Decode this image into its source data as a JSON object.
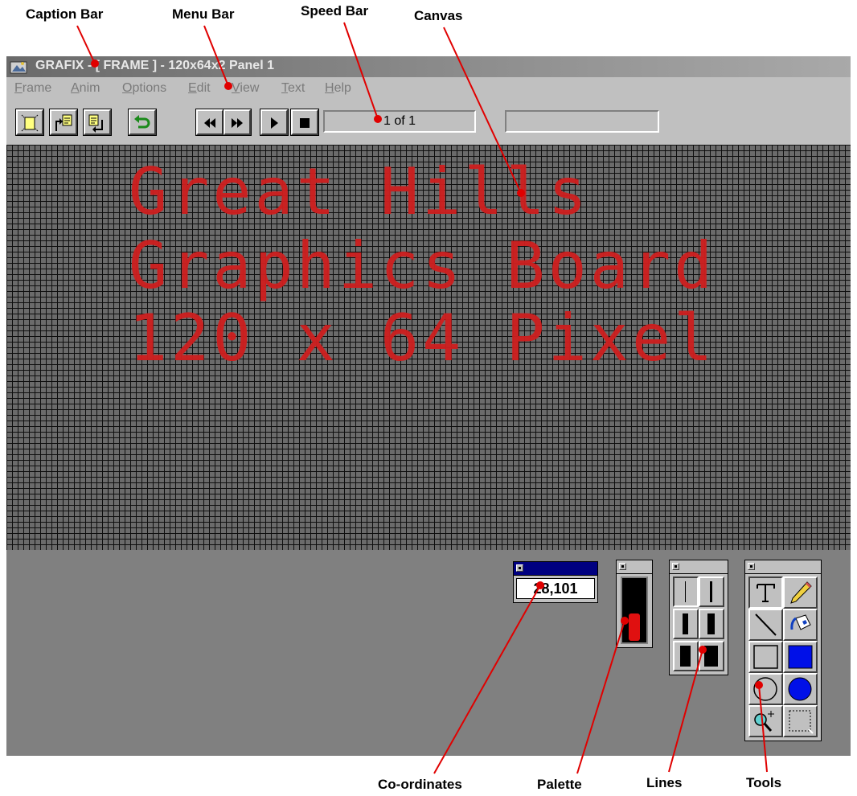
{
  "annotations": {
    "caption_bar": "Caption Bar",
    "menu_bar": "Menu Bar",
    "speed_bar": "Speed Bar",
    "canvas": "Canvas",
    "coordinates": "Co-ordinates",
    "palette": "Palette",
    "lines": "Lines",
    "tools": "Tools"
  },
  "window": {
    "title": "GRAFIX - [ FRAME ] - 120x64x2 Panel 1"
  },
  "menu": [
    {
      "label": "Frame",
      "accel": "F",
      "rest": "rame"
    },
    {
      "label": "Anim",
      "accel": "A",
      "rest": "nim"
    },
    {
      "label": "Options",
      "accel": "O",
      "rest": "ptions"
    },
    {
      "label": "Edit",
      "accel": "E",
      "rest": "dit"
    },
    {
      "label": "View",
      "accel": "V",
      "rest": "iew"
    },
    {
      "label": "Text",
      "accel": "T",
      "rest": "ext"
    },
    {
      "label": "Help",
      "accel": "H",
      "rest": "elp"
    }
  ],
  "toolbar": {
    "buttons": [
      "new-frame-icon",
      "copy-frame-icon",
      "paste-frame-icon",
      "undo-icon",
      "rewind-icon",
      "fast-forward-icon",
      "play-icon",
      "stop-icon"
    ],
    "frame_counter": "1 of 1",
    "status_field": ""
  },
  "canvas": {
    "lines": [
      "Great Hills",
      "Graphics Board",
      "120 x 64 Pixel"
    ],
    "pixel_color": "#cf1f1f"
  },
  "coordinates": {
    "value": "28,101"
  },
  "palette": {
    "current_color": "#e01010"
  },
  "tools": [
    "text-tool-icon",
    "pencil-icon",
    "line-tool-icon",
    "fill-bucket-icon",
    "rectangle-icon",
    "filled-rectangle-icon",
    "ellipse-icon",
    "filled-ellipse-icon",
    "zoom-icon",
    "selection-icon"
  ]
}
